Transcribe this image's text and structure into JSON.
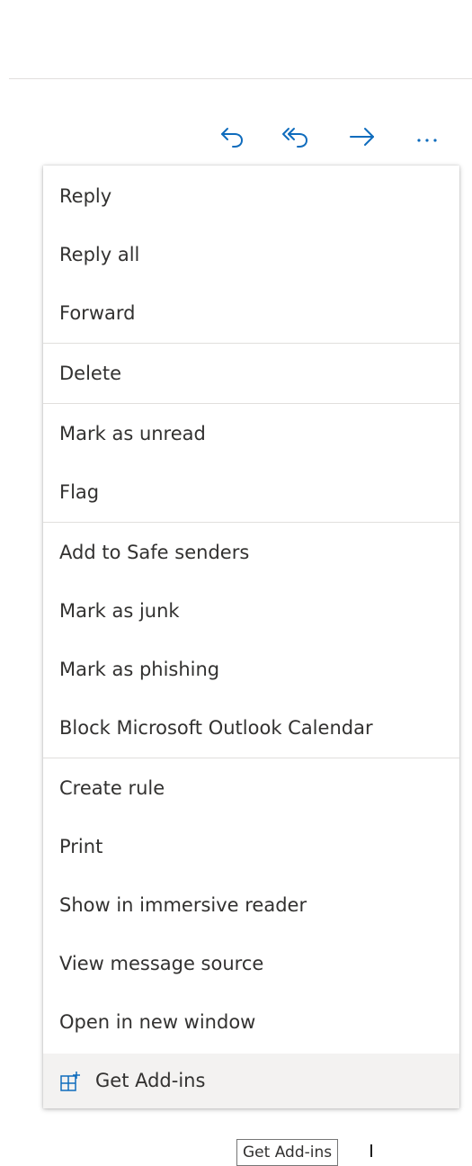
{
  "toolbar": {
    "icons": [
      "reply-icon",
      "reply-all-icon",
      "forward-icon",
      "more-icon"
    ],
    "accent_color": "#0f6cbd"
  },
  "menu": {
    "groups": [
      [
        "Reply",
        "Reply all",
        "Forward"
      ],
      [
        "Delete"
      ],
      [
        "Mark as unread",
        "Flag"
      ],
      [
        "Add to Safe senders",
        "Mark as junk",
        "Mark as phishing",
        "Block Microsoft Outlook Calendar"
      ],
      [
        "Create rule",
        "Print",
        "Show in immersive reader",
        "View message source",
        "Open in new window"
      ]
    ],
    "addins_label": "Get Add-ins",
    "addins_icon": "add-ins-icon"
  },
  "tooltip": {
    "text": "Get Add-ins"
  },
  "colors": {
    "text": "#323130",
    "divider": "#e1dfdd",
    "hover": "#f3f2f1"
  }
}
